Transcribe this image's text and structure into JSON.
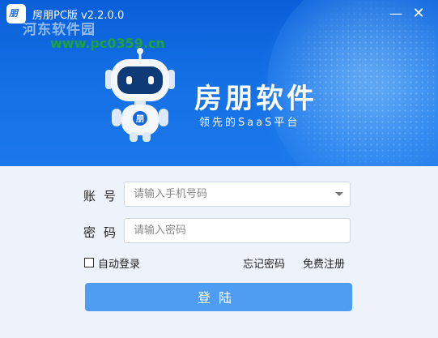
{
  "window": {
    "title": "房朋PC版 v2.2.0.0",
    "minimize_glyph": "—",
    "close_glyph": "✕",
    "logo_text": "朋"
  },
  "watermark": {
    "text": "河东软件园",
    "url": "www.pc0359.cn"
  },
  "brand": {
    "name": "房朋软件",
    "slogan": "领先的SaaS平台",
    "robot_badge": "朋"
  },
  "form": {
    "account_label": "账号",
    "account_placeholder": "请输入手机号码",
    "password_label": "密码",
    "password_placeholder": "请输入密码",
    "auto_login_label": "自动登录",
    "auto_login_checked": false,
    "forgot_label": "忘记密码",
    "register_label": "免费注册",
    "login_label": "登陆"
  },
  "colors": {
    "banner": "#1571e6",
    "button": "#4f9df3",
    "background": "#eef3fb"
  }
}
